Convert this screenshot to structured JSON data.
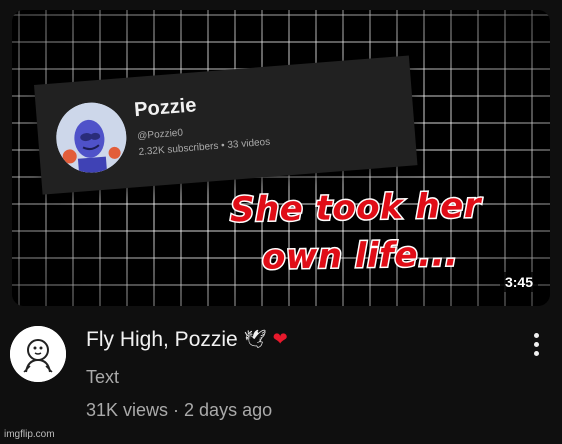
{
  "thumbnail": {
    "channel_card": {
      "name": "Pozzie",
      "handle": "@Pozzie0",
      "meta": "2.32K subscribers • 33 videos"
    },
    "overlay_line1": "She took her",
    "overlay_line2": "own life...",
    "duration": "3:45"
  },
  "video": {
    "title": "Fly High, Pozzie",
    "title_emojis": [
      "🕊",
      "❤"
    ],
    "description": "Text",
    "stats": "31K views · 2 days ago"
  },
  "watermark": "imgflip.com",
  "colors": {
    "background": "#0f0f0f",
    "overlay_red": "#e00d17",
    "secondary_text": "#aaaaaa"
  }
}
